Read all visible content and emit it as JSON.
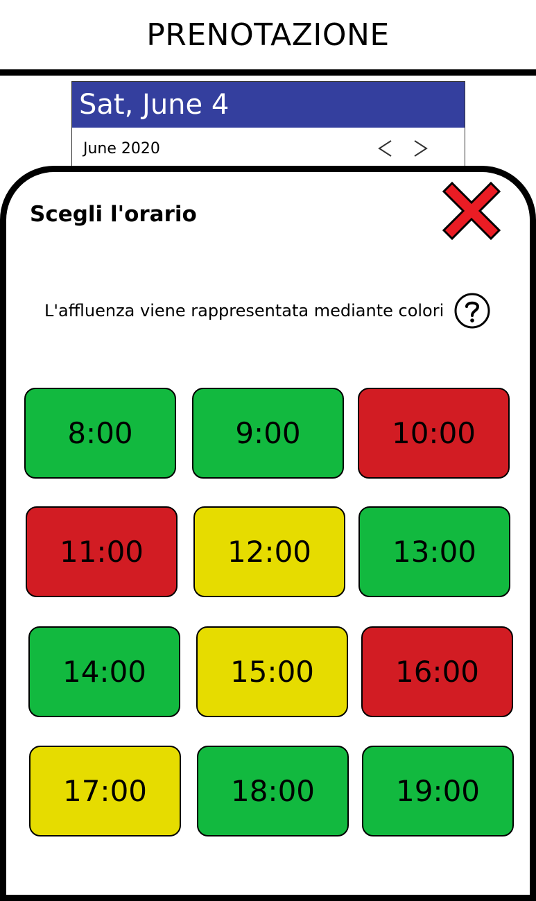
{
  "header": {
    "title": "PRENOTAZIONE"
  },
  "calendar": {
    "selected_date": "Sat, June 4",
    "month_label": "June 2020",
    "prev_icon": "chevron-left-icon",
    "next_icon": "chevron-right-icon",
    "accent": "#343f9e"
  },
  "sheet": {
    "title": "Scegli l'orario",
    "close_icon": "close-x-icon",
    "info_text": "L'affluenza viene rappresentata mediante colori",
    "help_icon": "question-circle-icon"
  },
  "colors": {
    "green": "#12b93f",
    "red": "#d21c23",
    "yellow": "#e6dc00"
  },
  "slots": [
    {
      "time": "8:00",
      "status": "green"
    },
    {
      "time": "9:00",
      "status": "green"
    },
    {
      "time": "10:00",
      "status": "red"
    },
    {
      "time": "11:00",
      "status": "red"
    },
    {
      "time": "12:00",
      "status": "yellow"
    },
    {
      "time": "13:00",
      "status": "green"
    },
    {
      "time": "14:00",
      "status": "green"
    },
    {
      "time": "15:00",
      "status": "yellow"
    },
    {
      "time": "16:00",
      "status": "red"
    },
    {
      "time": "17:00",
      "status": "yellow"
    },
    {
      "time": "18:00",
      "status": "green"
    },
    {
      "time": "19:00",
      "status": "green"
    }
  ]
}
